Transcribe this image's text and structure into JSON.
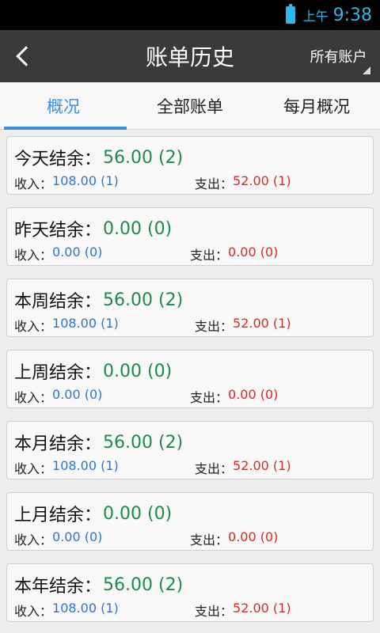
{
  "status": {
    "ampm": "上午",
    "time": "9:38"
  },
  "header": {
    "title": "账单历史",
    "account_selector": "所有账户"
  },
  "tabs": [
    {
      "label": "概况",
      "active": true
    },
    {
      "label": "全部账单",
      "active": false
    },
    {
      "label": "每月概况",
      "active": false
    }
  ],
  "labels": {
    "income": "收入：",
    "expense": "支出："
  },
  "cards": [
    {
      "period": "今天结余：",
      "balance": "56.00 (2)",
      "income": "108.00 (1)",
      "expense": "52.00 (1)"
    },
    {
      "period": "昨天结余：",
      "balance": "0.00 (0)",
      "income": "0.00 (0)",
      "expense": "0.00 (0)"
    },
    {
      "period": "本周结余：",
      "balance": "56.00 (2)",
      "income": "108.00 (1)",
      "expense": "52.00 (1)"
    },
    {
      "period": "上周结余：",
      "balance": "0.00 (0)",
      "income": "0.00 (0)",
      "expense": "0.00 (0)"
    },
    {
      "period": "本月结余：",
      "balance": "56.00 (2)",
      "income": "108.00 (1)",
      "expense": "52.00 (1)"
    },
    {
      "period": "上月结余：",
      "balance": "0.00 (0)",
      "income": "0.00 (0)",
      "expense": "0.00 (0)"
    },
    {
      "period": "本年结余：",
      "balance": "56.00 (2)",
      "income": "108.00 (1)",
      "expense": "52.00 (1)"
    }
  ],
  "colors": {
    "accent": "#3c8ee0",
    "balance": "#1f8a4c",
    "income": "#2a76d2",
    "expense": "#e0261d"
  }
}
